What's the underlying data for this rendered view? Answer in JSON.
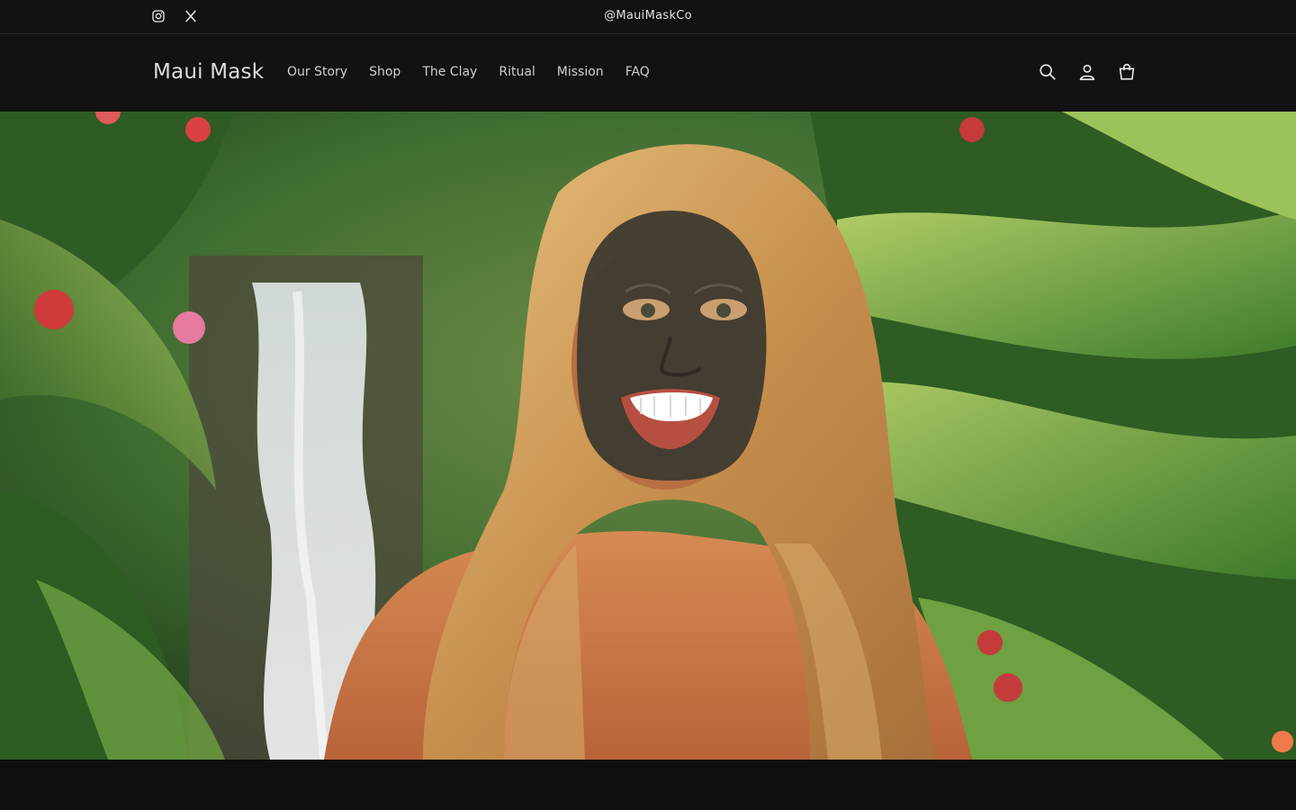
{
  "announcement": {
    "handle": "@MauiMaskCo",
    "social": [
      {
        "name": "instagram-icon"
      },
      {
        "name": "x-icon"
      }
    ]
  },
  "header": {
    "logo": "Maui Mask",
    "nav": [
      {
        "label": "Our Story"
      },
      {
        "label": "Shop"
      },
      {
        "label": "The Clay"
      },
      {
        "label": "Ritual"
      },
      {
        "label": "Mission"
      },
      {
        "label": "FAQ"
      }
    ],
    "icons": [
      "search-icon",
      "account-icon",
      "cart-icon"
    ]
  },
  "hero": {
    "image": "photo of smiling woman with dark clay face mask in tropical garden with waterfall"
  },
  "colors": {
    "background": "#121212",
    "text": "#e8e8e8"
  }
}
